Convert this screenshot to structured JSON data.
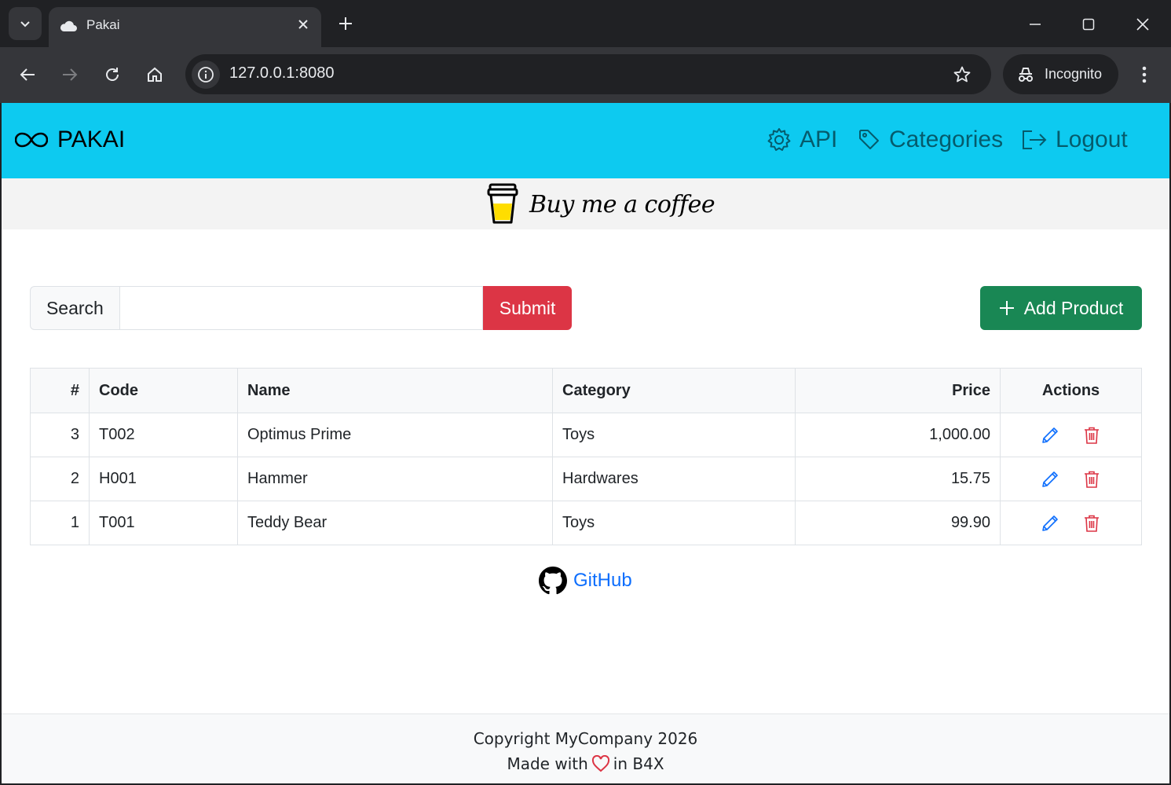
{
  "browser": {
    "tab_title": "Pakai",
    "url": "127.0.0.1:8080",
    "incognito_label": "Incognito"
  },
  "navbar": {
    "brand": "PAKAI",
    "links": [
      {
        "label": "API",
        "icon": "gear-icon"
      },
      {
        "label": "Categories",
        "icon": "tag-icon"
      },
      {
        "label": "Logout",
        "icon": "logout-icon"
      }
    ]
  },
  "banner": {
    "text": "Buy me a coffee"
  },
  "search": {
    "label": "Search",
    "value": "",
    "placeholder": "",
    "submit_label": "Submit"
  },
  "add_product_label": "Add Product",
  "table": {
    "headers": [
      "#",
      "Code",
      "Name",
      "Category",
      "Price",
      "Actions"
    ],
    "rows": [
      {
        "id": "3",
        "code": "T002",
        "name": "Optimus Prime",
        "category": "Toys",
        "price": "1,000.00"
      },
      {
        "id": "2",
        "code": "H001",
        "name": "Hammer",
        "category": "Hardwares",
        "price": "15.75"
      },
      {
        "id": "1",
        "code": "T001",
        "name": "Teddy Bear",
        "category": "Toys",
        "price": "99.90"
      }
    ]
  },
  "github_label": "GitHub",
  "footer": {
    "copyright": "Copyright MyCompany 2026",
    "made_with_prefix": "Made with",
    "made_with_suffix": "in B4X"
  },
  "colors": {
    "navbar": "#0dcaf0",
    "submit": "#dc3545",
    "add": "#198754",
    "link": "#0d6efd",
    "delete": "#dc3545"
  }
}
